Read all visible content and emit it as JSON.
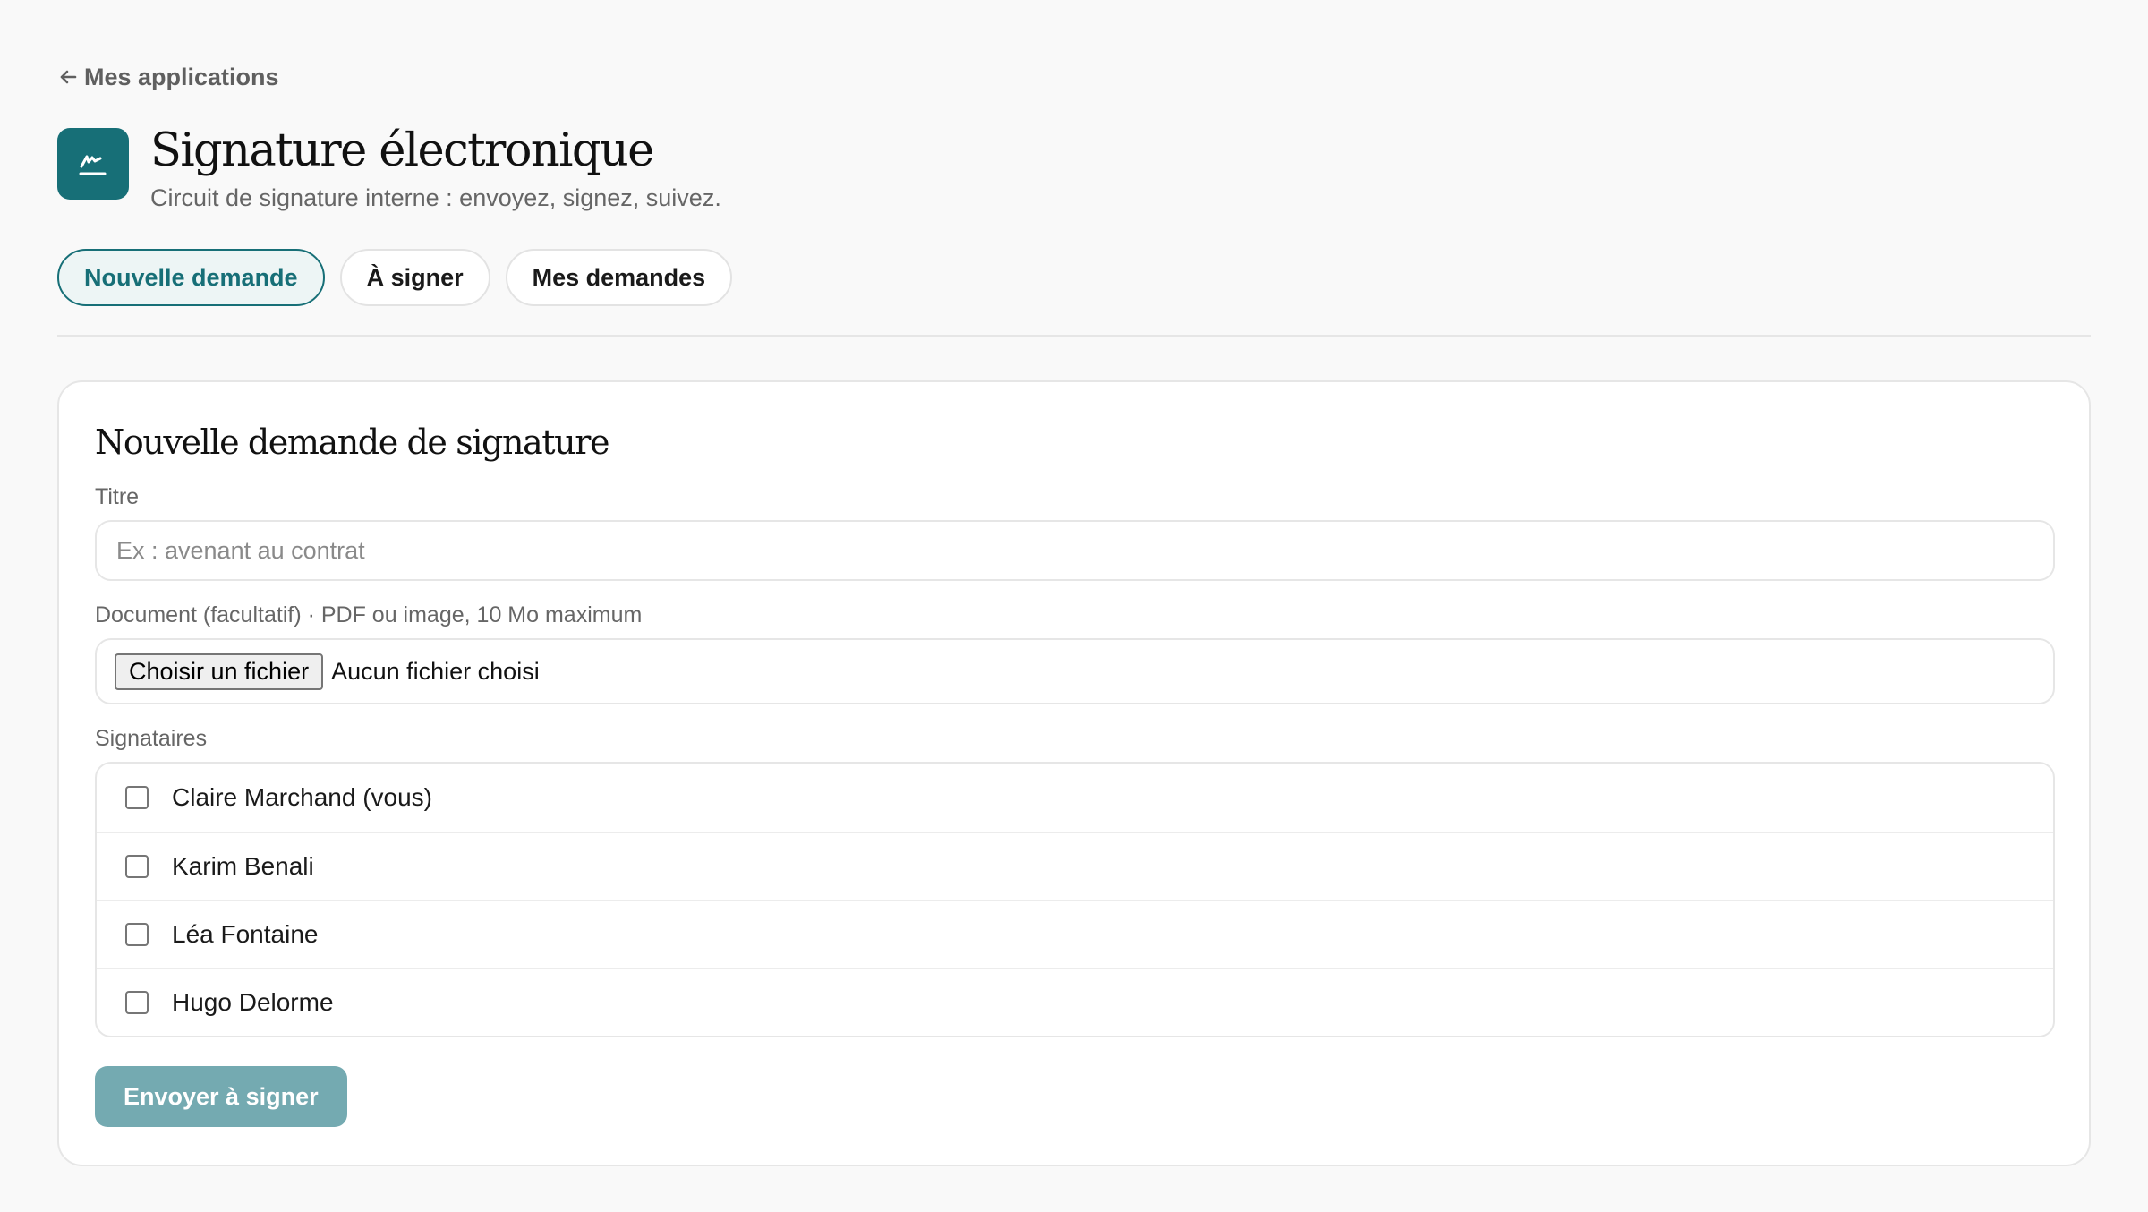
{
  "nav": {
    "back_label": "Mes applications"
  },
  "app": {
    "title": "Signature électronique",
    "subtitle": "Circuit de signature interne : envoyez, signez, suivez.",
    "accent_color": "#176f77",
    "icon": "signature-icon"
  },
  "tabs": [
    {
      "label": "Nouvelle demande",
      "active": true
    },
    {
      "label": "À signer",
      "active": false
    },
    {
      "label": "Mes demandes",
      "active": false
    }
  ],
  "form": {
    "title": "Nouvelle demande de signature",
    "titre_label": "Titre",
    "titre_placeholder": "Ex : avenant au contrat",
    "titre_value": "",
    "document_label": "Document (facultatif) · PDF ou image, 10 Mo maximum",
    "file_button": "Choisir un fichier",
    "file_status": "Aucun fichier choisi",
    "signers_label": "Signataires",
    "signers": [
      {
        "name": "Claire Marchand (vous)",
        "checked": false
      },
      {
        "name": "Karim Benali",
        "checked": false
      },
      {
        "name": "Léa Fontaine",
        "checked": false
      },
      {
        "name": "Hugo Delorme",
        "checked": false
      }
    ],
    "submit_label": "Envoyer à signer",
    "submit_color": "#74aab1"
  }
}
